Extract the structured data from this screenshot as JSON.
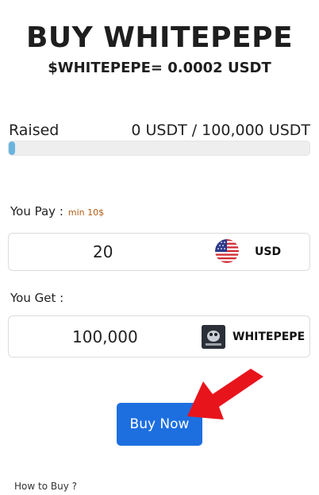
{
  "header": {
    "title": "BUY WHITEPEPE",
    "price_line": "$WHITEPEPE= 0.0002 USDT"
  },
  "raised": {
    "label": "Raised",
    "value": "0 USDT / 100,000 USDT",
    "progress_fraction": 0.02
  },
  "pay": {
    "label": "You Pay :",
    "min_note": "min 10$",
    "amount": "20",
    "currency": "USD",
    "currency_icon": "us-flag-icon"
  },
  "get": {
    "label": "You Get :",
    "amount": "100,000",
    "currency": "WHITEPEPE",
    "currency_icon": "whitepepe-token-icon"
  },
  "buy_button": {
    "label": "Buy Now"
  },
  "annotation": {
    "arrow_color": "#e8141c"
  },
  "howto": {
    "label": "How to Buy ?"
  }
}
